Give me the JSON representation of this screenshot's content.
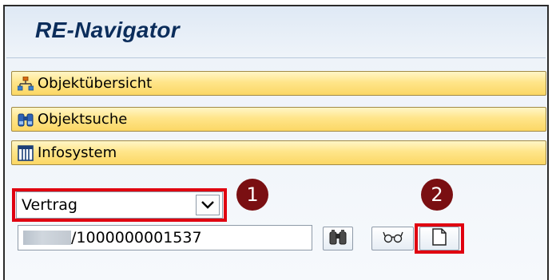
{
  "window": {
    "title": "RE-Navigator"
  },
  "nav": {
    "items": [
      {
        "label": "Objektübersicht",
        "icon": "hierarchy-icon"
      },
      {
        "label": "Objektsuche",
        "icon": "binoculars-icon"
      },
      {
        "label": "Infosystem",
        "icon": "report-grid-icon"
      }
    ]
  },
  "object_type_select": {
    "value": "Vertrag"
  },
  "object_input": {
    "value": "/1000000001537"
  },
  "buttons": {
    "search": "binoculars-icon",
    "display": "glasses-icon",
    "create": "new-document-icon"
  },
  "callouts": {
    "one": "1",
    "two": "2"
  },
  "colors": {
    "highlight": "#e00010",
    "callout": "#7a0f12",
    "nav_button": "#ffe58a",
    "title": "#0b2d5b"
  }
}
